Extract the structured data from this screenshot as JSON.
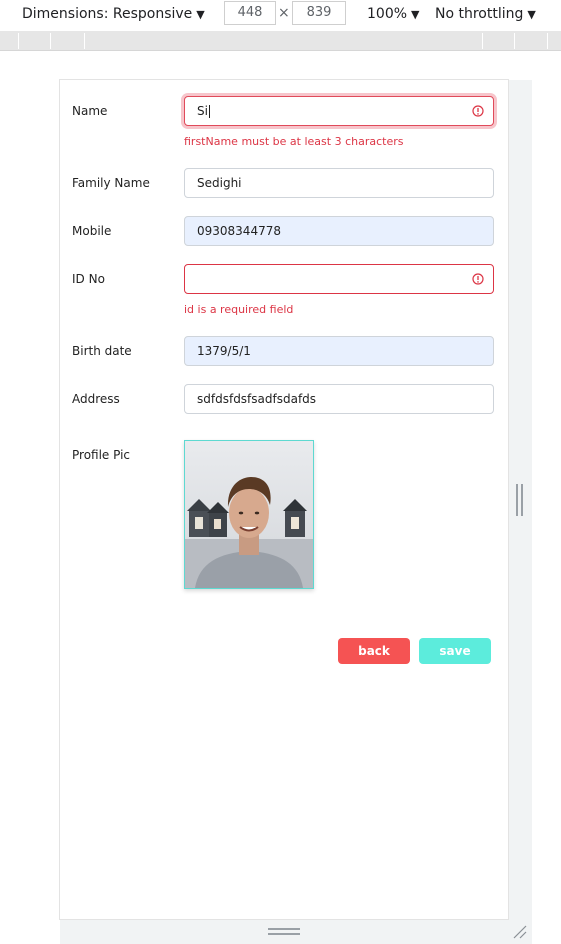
{
  "devtools": {
    "dimensions_label": "Dimensions: Responsive",
    "width_value": "448",
    "times_sign": "×",
    "height_value": "839",
    "zoom_label": "100%",
    "throttling_label": "No throttling",
    "caret": "▼"
  },
  "form": {
    "name": {
      "label": "Name",
      "value": "Si",
      "error": "firstName must be at least 3 characters"
    },
    "family_name": {
      "label": "Family Name",
      "value": "Sedighi"
    },
    "mobile": {
      "label": "Mobile",
      "value": "09308344778"
    },
    "id_no": {
      "label": "ID No",
      "value": "",
      "error": "id is a required field"
    },
    "birth_date": {
      "label": "Birth date",
      "value": "1379/5/1"
    },
    "address": {
      "label": "Address",
      "value": "sdfdsfdsfsadfsdafds"
    },
    "profile_pic": {
      "label": "Profile Pic"
    },
    "back_label": "back",
    "save_label": "save"
  },
  "colors": {
    "error": "#dc3545",
    "autofill_bg": "#e8f0fe",
    "back_button": "#f55353",
    "save_button": "#5cecdc",
    "photo_border": "#5ed9d1"
  }
}
